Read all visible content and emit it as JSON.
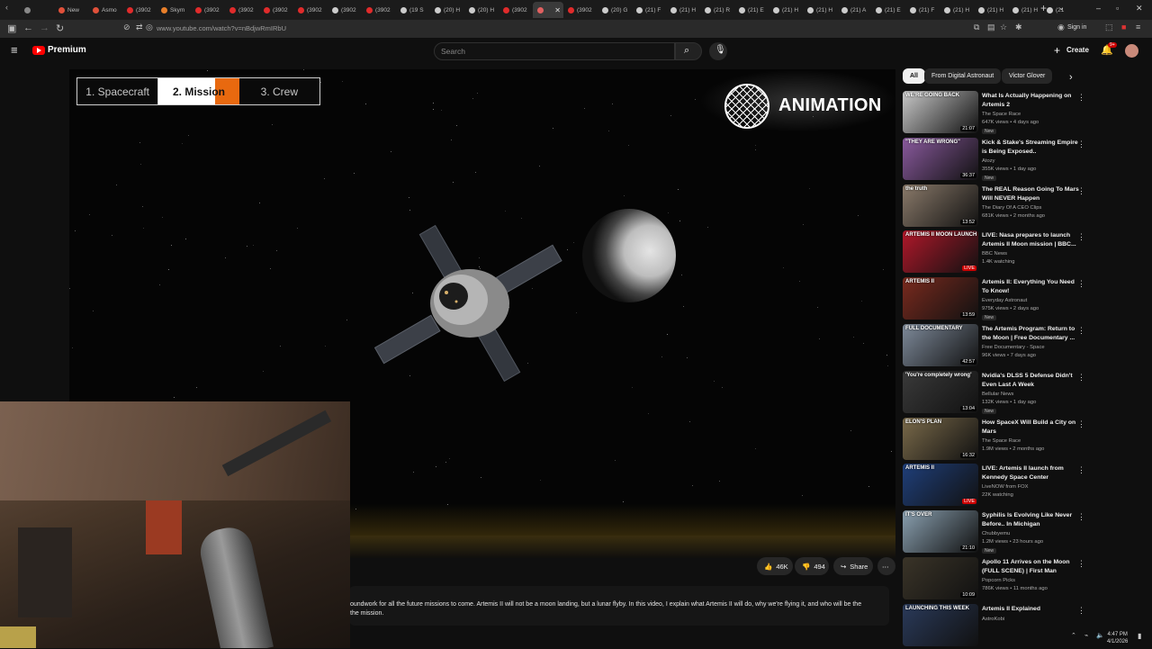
{
  "browser": {
    "tabs": [
      {
        "label": "",
        "color": "#888888"
      },
      {
        "label": "New",
        "color": "#e0503a"
      },
      {
        "label": "Asmo",
        "color": "#e0503a"
      },
      {
        "label": "(3902",
        "color": "#e02b2b"
      },
      {
        "label": "Skym",
        "color": "#e87f2a"
      },
      {
        "label": "(3902",
        "color": "#e02b2b"
      },
      {
        "label": "(3902",
        "color": "#e02b2b"
      },
      {
        "label": "(3902",
        "color": "#e02b2b"
      },
      {
        "label": "(3902",
        "color": "#e02b2b"
      },
      {
        "label": "(3902",
        "color": "#cccccc"
      },
      {
        "label": "(3902",
        "color": "#e02b2b"
      },
      {
        "label": "(19 S",
        "color": "#cccccc"
      },
      {
        "label": "(20) H",
        "color": "#cccccc"
      },
      {
        "label": "(20) H",
        "color": "#cccccc"
      },
      {
        "label": "(3902",
        "color": "#e02b2b"
      },
      {
        "label": "",
        "color": "#e06060",
        "active": true
      },
      {
        "label": "(3902",
        "color": "#e02b2b"
      },
      {
        "label": "(20) G",
        "color": "#cccccc"
      },
      {
        "label": "(21) F",
        "color": "#cccccc"
      },
      {
        "label": "(21) H",
        "color": "#cccccc"
      },
      {
        "label": "(21) R",
        "color": "#cccccc"
      },
      {
        "label": "(21) E",
        "color": "#cccccc"
      },
      {
        "label": "(21) H",
        "color": "#cccccc"
      },
      {
        "label": "(21) H",
        "color": "#cccccc"
      },
      {
        "label": "(21) A",
        "color": "#cccccc"
      },
      {
        "label": "(21) E",
        "color": "#cccccc"
      },
      {
        "label": "(21) F",
        "color": "#cccccc"
      },
      {
        "label": "(21) H",
        "color": "#cccccc"
      },
      {
        "label": "(21) H",
        "color": "#cccccc"
      },
      {
        "label": "(21) H",
        "color": "#cccccc"
      },
      {
        "label": "(21",
        "color": "#cccccc"
      }
    ],
    "url": "www.youtube.com/watch?v=nBdjwRmIRbU",
    "sign_in": "Sign in"
  },
  "youtube": {
    "logo_text": "Premium",
    "search_placeholder": "Search",
    "create_label": "Create",
    "notif_badge": "9+"
  },
  "video": {
    "chapters": [
      "1. Spacecraft",
      "2. Mission",
      "3. Crew"
    ],
    "active_chapter": 1,
    "overlay_label": "ANIMATION"
  },
  "actions": {
    "likes": "46K",
    "dislikes": "494",
    "share": "Share"
  },
  "description": {
    "line1": "oundwork for all the future missions to come. Artemis II will not be a moon landing, but a lunar flyby. In this video, I explain what Artemis II will do, why we're flying it, and who will be the",
    "line2": "the mission."
  },
  "chips": [
    "All",
    "From Digital Astronaut",
    "Victor Glover"
  ],
  "recommendations": [
    {
      "title": "What Is Actually Happening on Artemis 2",
      "channel": "The Space Race",
      "meta": "647K views • 4 days ago",
      "badge": "New",
      "duration": "21:07",
      "thumb_text": "WE'RE GOING BACK",
      "thumb_color": "#c9c9c9"
    },
    {
      "title": "Kick & Stake's Streaming Empire is Being Exposed..",
      "channel": "Atozy",
      "meta": "355K views • 1 day ago",
      "badge": "New",
      "duration": "36:37",
      "thumb_text": "\"THEY ARE WRONG\"",
      "thumb_color": "#8a5a9e"
    },
    {
      "title": "The REAL Reason Going To Mars Will NEVER Happen",
      "channel": "The Diary Of A CEO Clips",
      "meta": "681K views • 2 months ago",
      "badge": "",
      "duration": "13:52",
      "thumb_text": "the truth",
      "thumb_color": "#8a7a6a"
    },
    {
      "title": "LIVE: Nasa prepares to launch Artemis II Moon mission | BBC...",
      "channel": "BBC News",
      "meta": "1.4K watching",
      "badge": "",
      "duration": "LIVE",
      "thumb_text": "ARTEMIS II MOON LAUNCH",
      "thumb_color": "#b0182a"
    },
    {
      "title": "Artemis II: Everything You Need To Know!",
      "channel": "Everyday Astronaut",
      "meta": "975K views • 2 days ago",
      "badge": "New",
      "duration": "13:59",
      "thumb_text": "ARTEMIS II",
      "thumb_color": "#7a2a1e"
    },
    {
      "title": "The Artemis Program: Return to the Moon | Free Documentary ...",
      "channel": "Free Documentary - Space",
      "meta": "96K views • 7 days ago",
      "badge": "",
      "duration": "42:57",
      "thumb_text": "FULL DOCUMENTARY",
      "thumb_color": "#7e8a9a"
    },
    {
      "title": "Nvidia's DLSS 5 Defense Didn't Even Last A Week",
      "channel": "Bellular News",
      "meta": "132K views • 1 day ago",
      "badge": "New",
      "duration": "13:04",
      "thumb_text": "'You're completely wrong'",
      "thumb_color": "#3a3a3a"
    },
    {
      "title": "How SpaceX Will Build a City on Mars",
      "channel": "The Space Race",
      "meta": "1.9M views • 2 months ago",
      "badge": "",
      "duration": "16:32",
      "thumb_text": "ELON'S PLAN",
      "thumb_color": "#7a6a4a"
    },
    {
      "title": "LIVE: Artemis II launch from Kennedy Space Center",
      "channel": "LiveNOW from FOX",
      "meta": "22K watching",
      "badge": "",
      "duration": "LIVE",
      "thumb_text": "ARTEMIS II",
      "thumb_color": "#1f3f7a"
    },
    {
      "title": "Syphilis Is Evolving Like Never Before.. In Michigan",
      "channel": "Chubbyemu",
      "meta": "1.2M views • 23 hours ago",
      "badge": "New",
      "duration": "21:10",
      "thumb_text": "IT'S OVER",
      "thumb_color": "#8aa0b0"
    },
    {
      "title": "Apollo 11 Arrives on the Moon (FULL SCENE) | First Man",
      "channel": "Popcorn Picks",
      "meta": "786K views • 11 months ago",
      "badge": "",
      "duration": "10:09",
      "thumb_text": "",
      "thumb_color": "#3a3428"
    },
    {
      "title": "Artemis II Explained",
      "channel": "AstroKobi",
      "meta": "",
      "badge": "",
      "duration": "",
      "thumb_text": "LAUNCHING THIS WEEK",
      "thumb_color": "#2a3a5a"
    }
  ],
  "clock": {
    "time": "4:47 PM",
    "date": "4/1/2026"
  }
}
